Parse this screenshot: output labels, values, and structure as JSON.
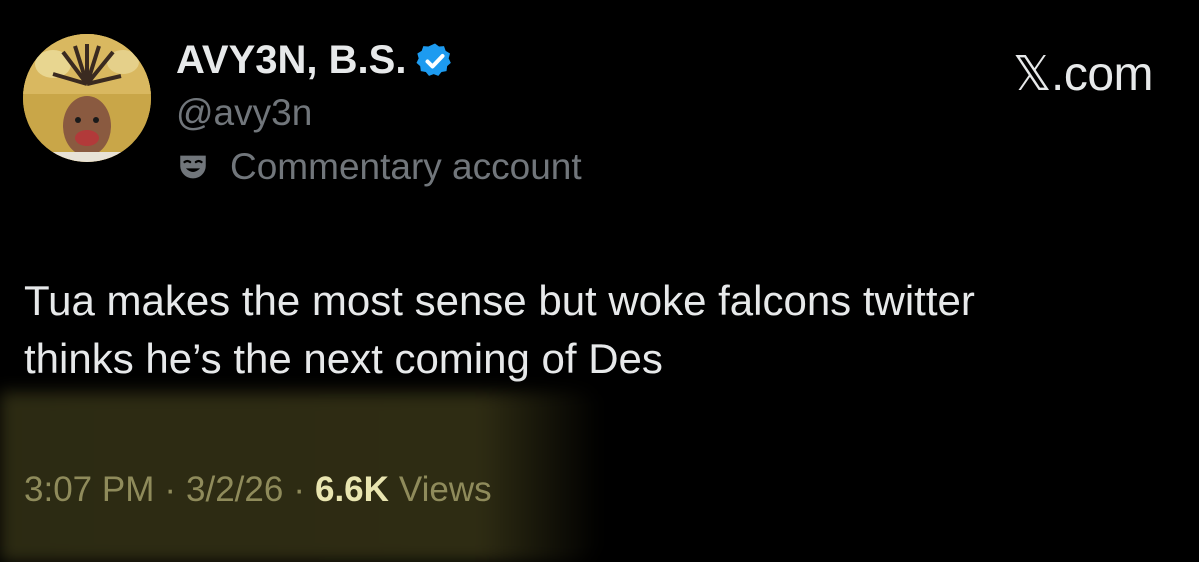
{
  "profile": {
    "display_name": "AVY3N, B.S.",
    "handle": "@avy3n",
    "label": "Commentary account"
  },
  "brand": "𝕏.com",
  "tweet": {
    "text_line1": "Tua makes the most sense but woke falcons twitter",
    "text_line2": "thinks he’s the next coming of Des"
  },
  "meta": {
    "time": "3:07 PM",
    "separator": "·",
    "date": "3/2/26",
    "views_count": "6.6K",
    "views_label": "Views"
  },
  "colors": {
    "background": "#000000",
    "primary_text": "#e7e9ea",
    "secondary_text": "#71767b",
    "verified_blue": "#1d9bf0",
    "highlight": "#3a3718"
  }
}
